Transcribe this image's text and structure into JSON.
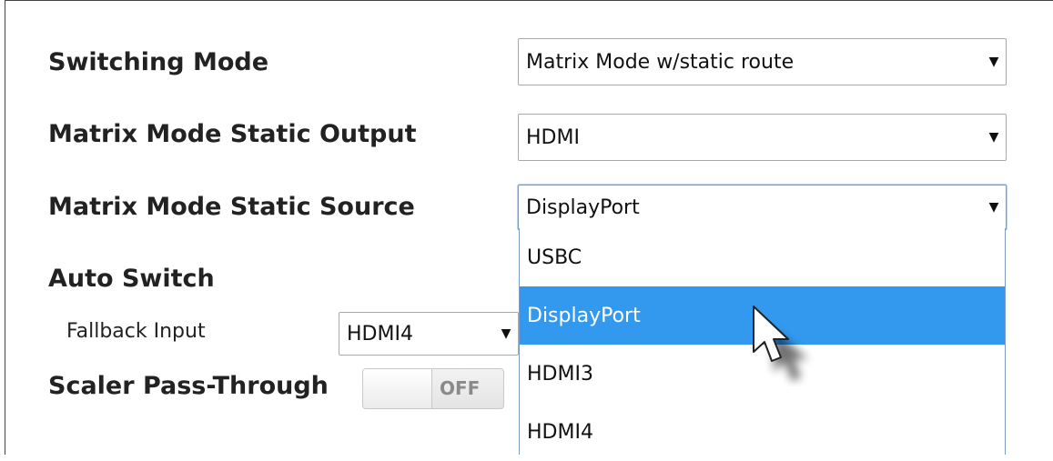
{
  "settings": {
    "switching_mode": {
      "label": "Switching Mode",
      "value": "Matrix Mode w/static route"
    },
    "static_output": {
      "label": "Matrix Mode Static Output",
      "value": "HDMI"
    },
    "static_source": {
      "label": "Matrix Mode Static Source",
      "value": "DisplayPort",
      "options": [
        "USBC",
        "DisplayPort",
        "HDMI3",
        "HDMI4"
      ]
    },
    "auto_switch": {
      "label": "Auto Switch",
      "fallback_label": "Fallback Input",
      "fallback_value": "HDMI4"
    },
    "scaler_pass_through": {
      "label": "Scaler Pass-Through",
      "state": "OFF"
    }
  },
  "icons": {
    "dropdown_arrow": "triangle-down-icon",
    "cursor": "pointer-cursor-icon"
  },
  "colors": {
    "selected_option": "#3399ee",
    "focus_border": "#6f9fd8",
    "text": "#222222"
  }
}
